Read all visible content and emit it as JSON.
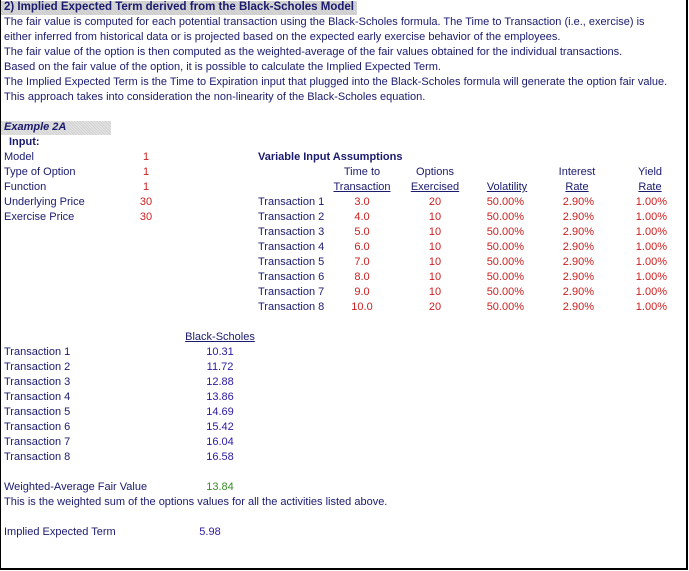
{
  "title": "2) Implied Expected Term derived from the Black-Scholes Model",
  "description": [
    "The fair value is computed for each potential transaction using the Black-Scholes formula.  The Time to Transaction (i.e., exercise) is",
    "  either inferred from historical data or is projected based on the expected early exercise behavior of the employees.",
    "The fair value of the option is then computed as the weighted-average of the fair values obtained for the individual transactions.",
    "Based on the fair value of the option, it is possible to calculate the Implied Expected Term.",
    "The Implied Expected Term is the Time to Expiration input that plugged into the Black-Scholes formula will generate the option fair value.",
    "This approach takes into consideration the non-linearity of the Black-Scholes equation."
  ],
  "example": {
    "label": "Example 2A",
    "input_label": "Input:",
    "inputs": [
      {
        "label": "Model",
        "value": "1"
      },
      {
        "label": "Type of Option",
        "value": "1"
      },
      {
        "label": "Function",
        "value": "1"
      },
      {
        "label": "Underlying Price",
        "value": "30"
      },
      {
        "label": "Exercise Price",
        "value": "30"
      }
    ]
  },
  "variable_inputs": {
    "heading": "Variable Input Assumptions",
    "columns": [
      {
        "top": "Time to",
        "bottom": "Transaction"
      },
      {
        "top": "Options",
        "bottom": "Exercised"
      },
      {
        "top": "",
        "bottom": "Volatility"
      },
      {
        "top": "Interest",
        "bottom": "Rate"
      },
      {
        "top": "Yield",
        "bottom": "Rate"
      }
    ],
    "rows": [
      {
        "label": "Transaction 1",
        "time": "3.0",
        "options": "20",
        "vol": "50.00%",
        "rate": "2.90%",
        "yield": "1.00%"
      },
      {
        "label": "Transaction 2",
        "time": "4.0",
        "options": "10",
        "vol": "50.00%",
        "rate": "2.90%",
        "yield": "1.00%"
      },
      {
        "label": "Transaction 3",
        "time": "5.0",
        "options": "10",
        "vol": "50.00%",
        "rate": "2.90%",
        "yield": "1.00%"
      },
      {
        "label": "Transaction 4",
        "time": "6.0",
        "options": "10",
        "vol": "50.00%",
        "rate": "2.90%",
        "yield": "1.00%"
      },
      {
        "label": "Transaction 5",
        "time": "7.0",
        "options": "10",
        "vol": "50.00%",
        "rate": "2.90%",
        "yield": "1.00%"
      },
      {
        "label": "Transaction 6",
        "time": "8.0",
        "options": "10",
        "vol": "50.00%",
        "rate": "2.90%",
        "yield": "1.00%"
      },
      {
        "label": "Transaction 7",
        "time": "9.0",
        "options": "10",
        "vol": "50.00%",
        "rate": "2.90%",
        "yield": "1.00%"
      },
      {
        "label": "Transaction 8",
        "time": "10.0",
        "options": "20",
        "vol": "50.00%",
        "rate": "2.90%",
        "yield": "1.00%"
      }
    ]
  },
  "results": {
    "header": "Black-Scholes",
    "rows": [
      {
        "label": "Transaction 1",
        "value": "10.31"
      },
      {
        "label": "Transaction 2",
        "value": "11.72"
      },
      {
        "label": "Transaction 3",
        "value": "12.88"
      },
      {
        "label": "Transaction 4",
        "value": "13.86"
      },
      {
        "label": "Transaction 5",
        "value": "14.69"
      },
      {
        "label": "Transaction 6",
        "value": "15.42"
      },
      {
        "label": "Transaction 7",
        "value": "16.04"
      },
      {
        "label": "Transaction 8",
        "value": "16.58"
      }
    ],
    "weighted_label": "Weighted-Average Fair Value",
    "weighted_value": "13.84",
    "weighted_note": "This is the weighted sum of the options values for all the activities listed above.",
    "implied_label": "Implied Expected Term",
    "implied_value": "5.98"
  }
}
